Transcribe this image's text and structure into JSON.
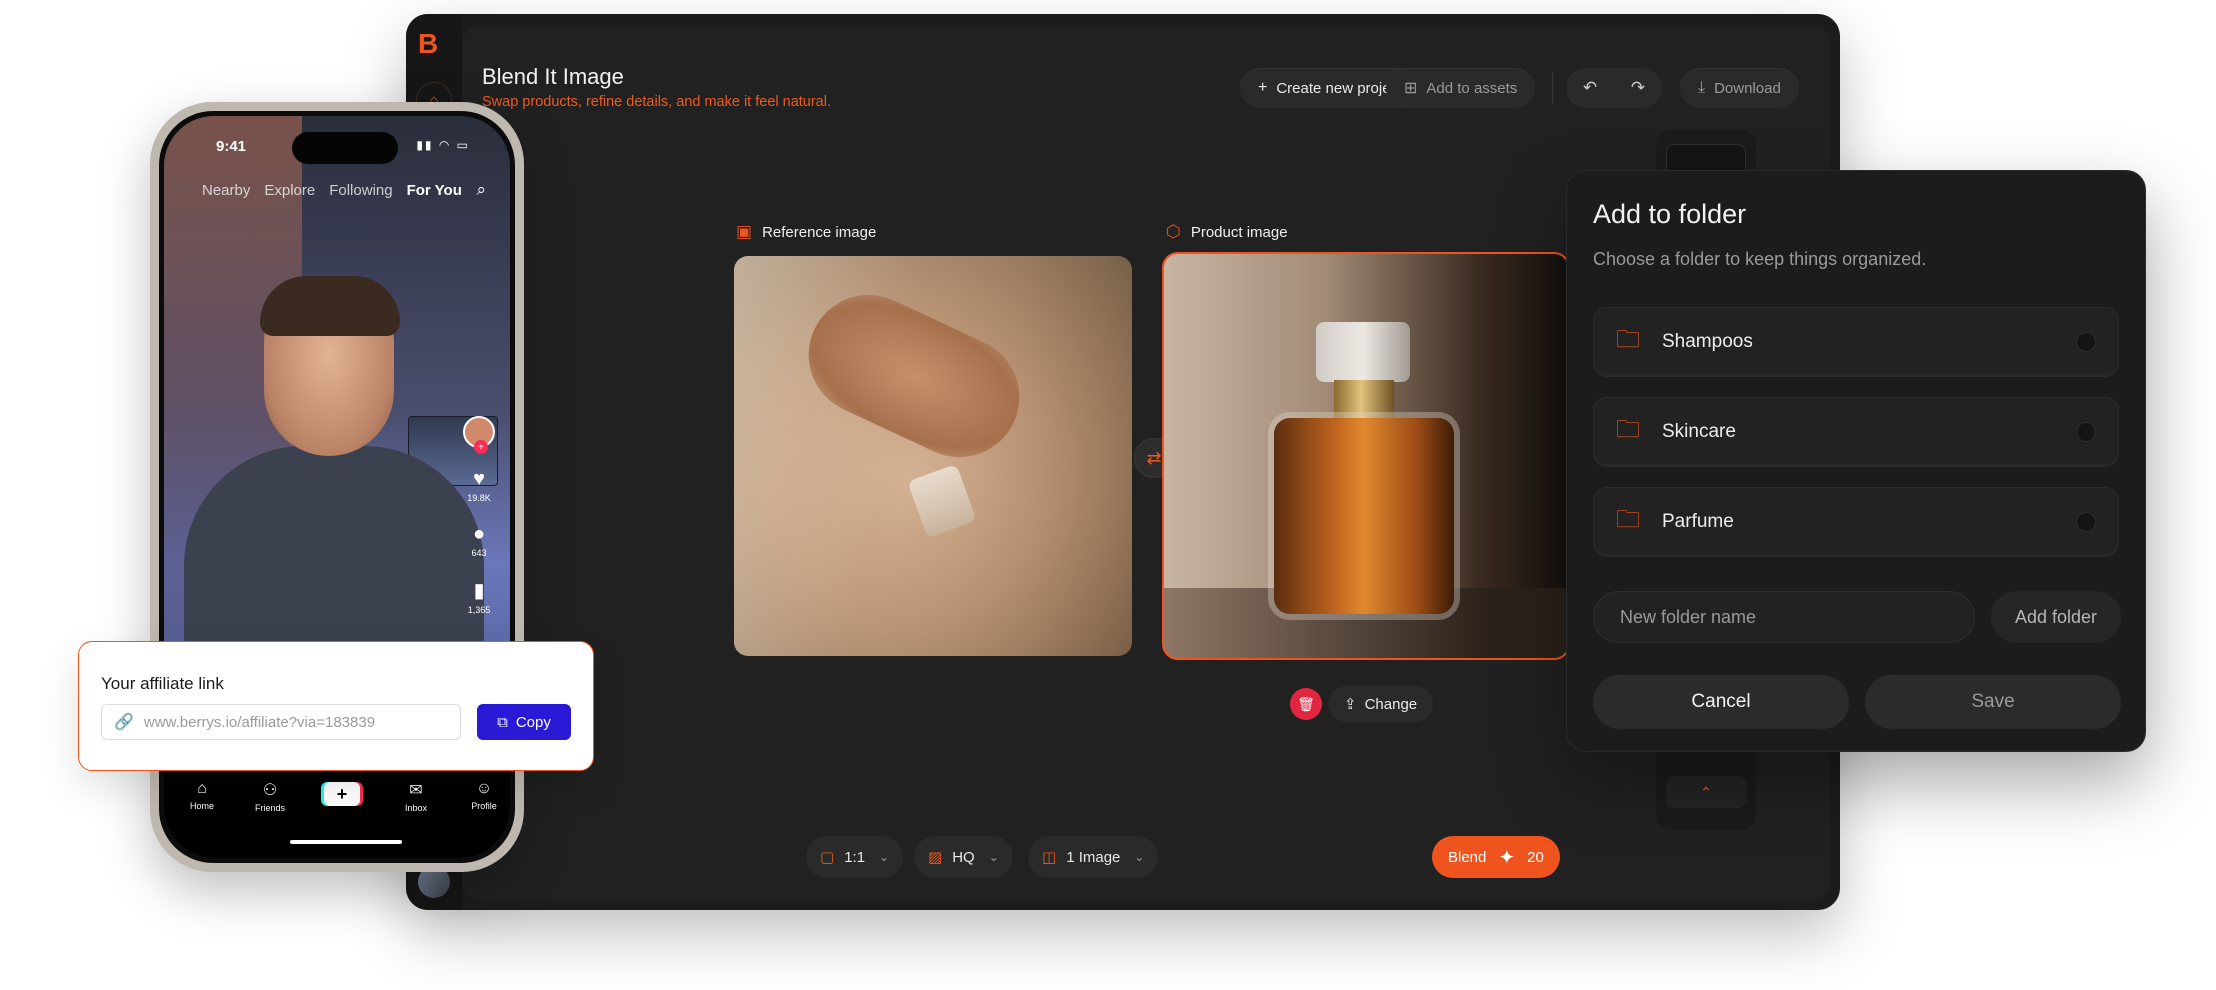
{
  "app": {
    "brand": "B",
    "title": "Blend It Image",
    "subtitle": "Swap products, refine details, and make it feel natural.",
    "toolbar": {
      "create_label": "Create new project",
      "assets_label": "Add to assets",
      "download_label": "Download"
    },
    "reference_label": "Reference image",
    "product_label": "Product image",
    "change_label": "Change",
    "options": {
      "ratio": "1:1",
      "quality": "HQ",
      "count": "1 Image"
    },
    "blend": {
      "label": "Blend",
      "credits": "20"
    },
    "colors": {
      "accent": "#f0541e",
      "danger": "#e1263f",
      "copy_button": "#2a1ad6"
    }
  },
  "dialog": {
    "title": "Add to folder",
    "subtitle": "Choose a folder to keep things organized.",
    "folders": [
      {
        "name": "Shampoos"
      },
      {
        "name": "Skincare"
      },
      {
        "name": "Parfume"
      }
    ],
    "new_folder_placeholder": "New folder name",
    "add_folder_label": "Add folder",
    "cancel_label": "Cancel",
    "save_label": "Save"
  },
  "phone": {
    "time": "9:41",
    "feed_tabs": [
      "Nearby",
      "Explore",
      "Following",
      "For You"
    ],
    "likes": "19.8K",
    "comments": "643",
    "saves": "1,365",
    "tabs": [
      "Home",
      "Friends",
      "Inbox",
      "Profile"
    ]
  },
  "affiliate": {
    "title": "Your affiliate link",
    "url": "www.berrys.io/affiliate?via=183839",
    "copy_label": "Copy"
  }
}
